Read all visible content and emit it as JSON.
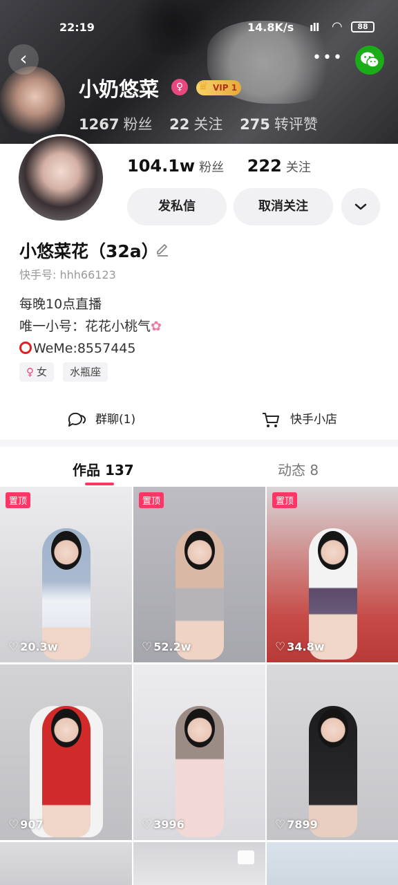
{
  "status_bar": {
    "time": "22:19",
    "network": "14.8K/s",
    "signal": ".ııll .ııll",
    "battery": "88"
  },
  "banner": {
    "name": "小奶悠菜",
    "vip_label": "VIP 1",
    "stats": [
      {
        "num": "1267",
        "label": "粉丝"
      },
      {
        "num": "22",
        "label": "关注"
      },
      {
        "num": "275",
        "label": "转评赞"
      }
    ]
  },
  "profile": {
    "followers_num": "104.1w",
    "followers_label": "粉丝",
    "following_num": "222",
    "following_label": "关注",
    "message_button": "发私信",
    "unfollow_button": "取消关注",
    "name": "小悠菜花（32a）",
    "kuaishou_id": "快手号: hhh66123",
    "bio": [
      "每晚10点直播",
      "唯一小号：花花小桃气",
      "WeMe:8557445"
    ],
    "tags": [
      "女",
      "水瓶座"
    ]
  },
  "links": {
    "group_chat": "群聊(1)",
    "shop": "快手小店"
  },
  "tabs": [
    {
      "label": "作品 137"
    },
    {
      "label": "动态 8"
    }
  ],
  "grid": {
    "pin_label": "置顶",
    "items": [
      {
        "likes": "20.3w",
        "pinned": true
      },
      {
        "likes": "52.2w",
        "pinned": true
      },
      {
        "likes": "34.8w",
        "pinned": true
      },
      {
        "likes": "907",
        "pinned": false
      },
      {
        "likes": "3996",
        "pinned": false
      },
      {
        "likes": "7899",
        "pinned": false
      }
    ]
  }
}
